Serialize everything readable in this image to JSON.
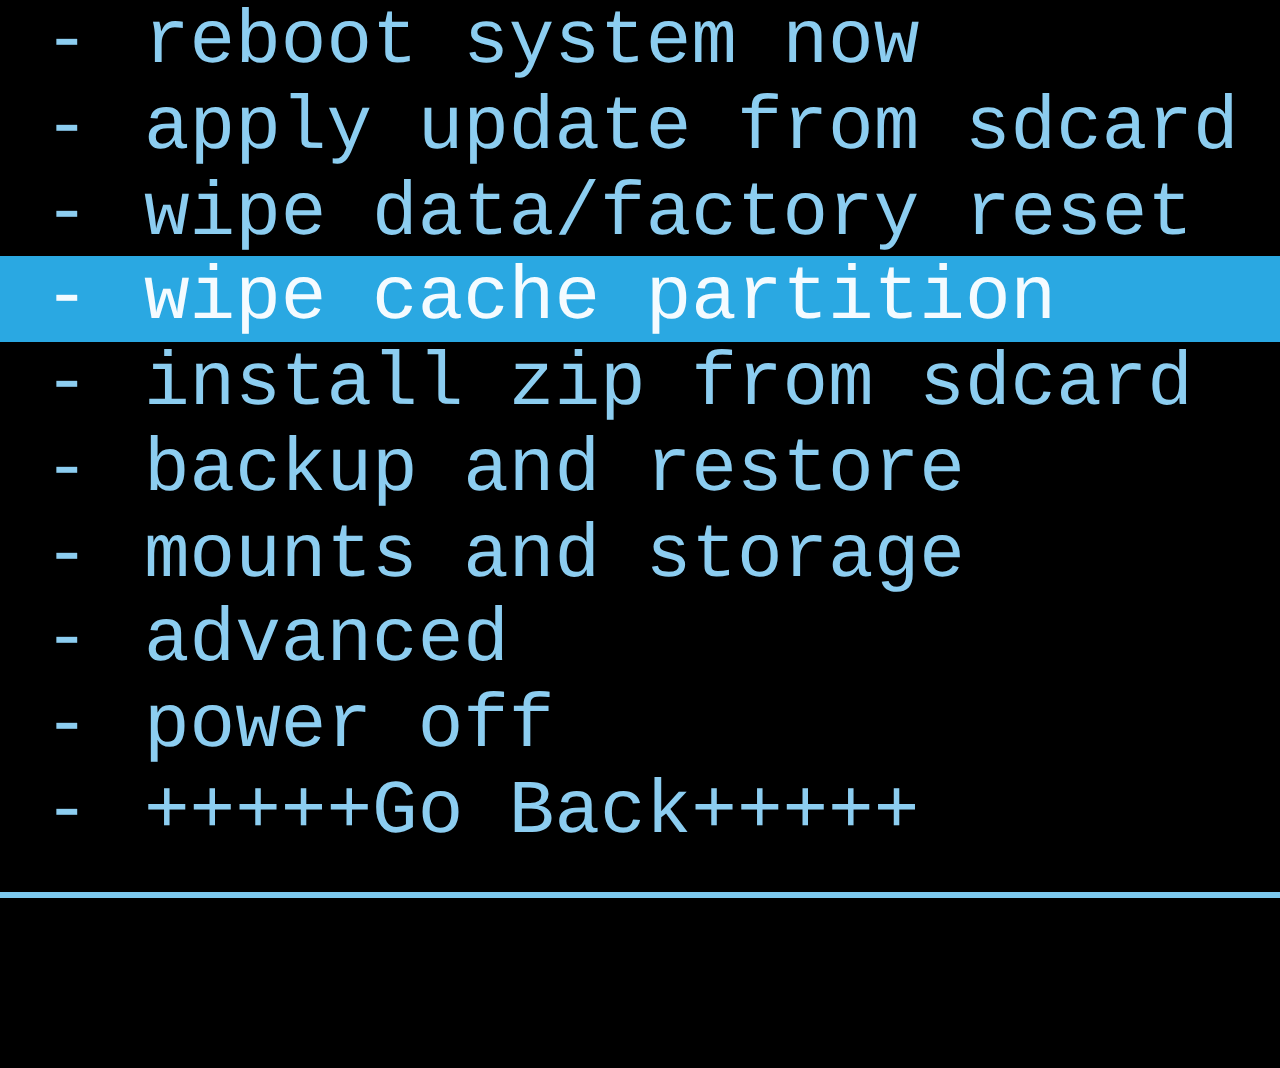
{
  "menu": [
    {
      "bullet": "-",
      "label": "reboot system now",
      "selected": false
    },
    {
      "bullet": "-",
      "label": "apply update from sdcard",
      "selected": false
    },
    {
      "bullet": "-",
      "label": "wipe data/factory reset",
      "selected": false
    },
    {
      "bullet": "-",
      "label": "wipe cache partition",
      "selected": true
    },
    {
      "bullet": "-",
      "label": "install zip from sdcard",
      "selected": false
    },
    {
      "bullet": "-",
      "label": "backup and restore",
      "selected": false
    },
    {
      "bullet": "-",
      "label": "mounts and storage",
      "selected": false
    },
    {
      "bullet": "-",
      "label": "advanced",
      "selected": false
    },
    {
      "bullet": "-",
      "label": "power off",
      "selected": false
    },
    {
      "bullet": "-",
      "label": "+++++Go Back+++++",
      "selected": false
    }
  ]
}
